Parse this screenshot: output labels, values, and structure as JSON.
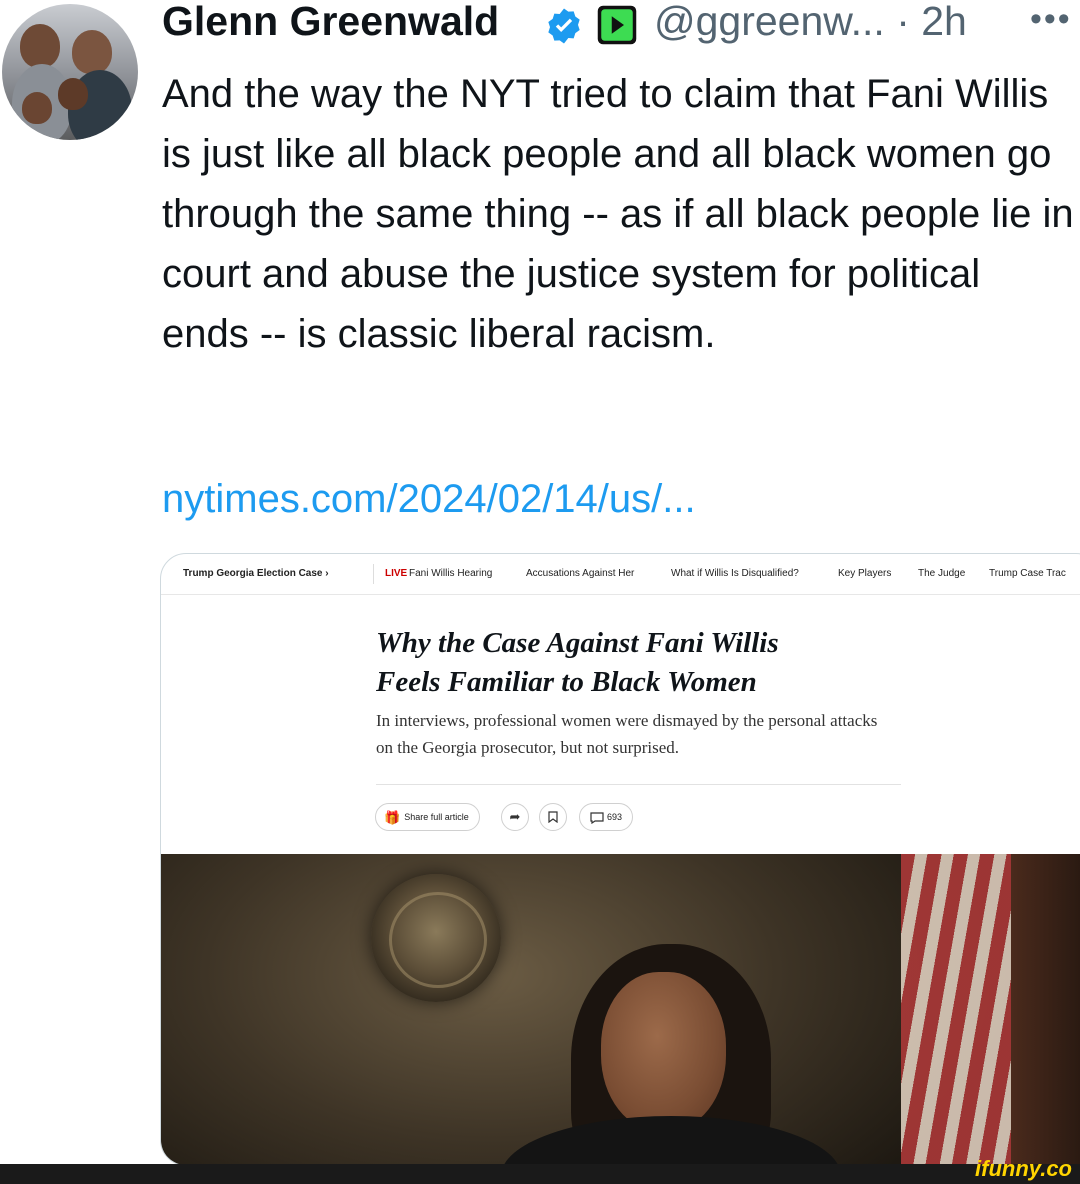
{
  "tweet": {
    "author_name": "Glenn Greenwald",
    "handle_time": "@ggreenw... · 2h",
    "more_icon": "•••",
    "text": "And the way the NYT tried to claim that Fani Willis is just like all black people and all black women go through the same thing -- as if all black people lie in court and abuse the justice system for political ends -- is classic liberal racism.",
    "link": "nytimes.com/2024/02/14/us/..."
  },
  "card": {
    "nav": {
      "section": "Trump Georgia Election Case ›",
      "live": "LIVE",
      "items": [
        "Fani Willis Hearing",
        "Accusations Against Her",
        "What if Willis Is Disqualified?",
        "Key Players",
        "The Judge",
        "Trump Case Trac"
      ]
    },
    "headline_line1": "Why the Case Against Fani Willis",
    "headline_line2": "Feels Familiar to Black Women",
    "summary": "In interviews, professional women were dismayed by the personal attacks on the Georgia prosecutor, but not surprised.",
    "share_label": "Share full article",
    "comment_count": "693"
  },
  "watermark": "ifunny.co",
  "colors": {
    "link": "#1d9bf0",
    "verified": "#1d9bf0",
    "muted": "#536471"
  },
  "icons": [
    "verified-icon",
    "affiliate-badge-icon",
    "more-icon",
    "gift-icon",
    "share-arrow-icon",
    "bookmark-icon",
    "comment-icon"
  ]
}
